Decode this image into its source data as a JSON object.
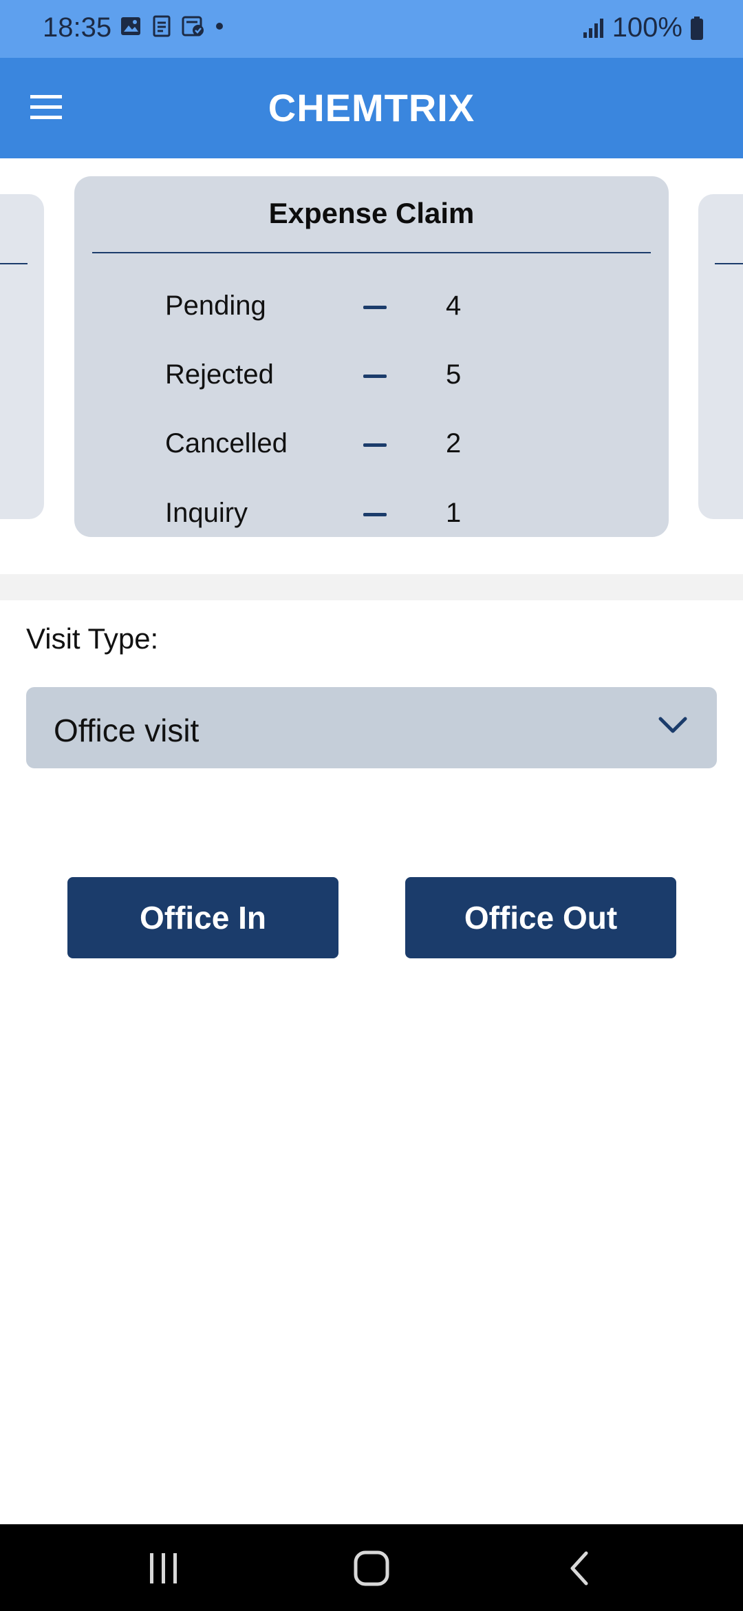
{
  "status_bar": {
    "time": "18:35",
    "battery": "100%",
    "icons": [
      "image-icon",
      "document-scan-icon",
      "task-check-icon",
      "dot-icon",
      "signal-icon",
      "battery-icon"
    ]
  },
  "app_bar": {
    "title": "CHEMTRIX",
    "menu_icon": "hamburger-menu-icon",
    "color": "#3a86de"
  },
  "card": {
    "title": "Expense Claim",
    "rows": [
      {
        "label": "Pending",
        "count": "4"
      },
      {
        "label": "Rejected",
        "count": "5"
      },
      {
        "label": "Cancelled",
        "count": "2"
      },
      {
        "label": "Inquiry",
        "count": "1"
      }
    ]
  },
  "visit": {
    "label": "Visit Type:",
    "selected": "Office visit"
  },
  "buttons": {
    "office_in": "Office In",
    "office_out": "Office Out",
    "color": "#1b3c6b"
  },
  "nav_bar": {
    "icons": [
      "recent-apps-icon",
      "home-icon",
      "back-icon"
    ]
  }
}
